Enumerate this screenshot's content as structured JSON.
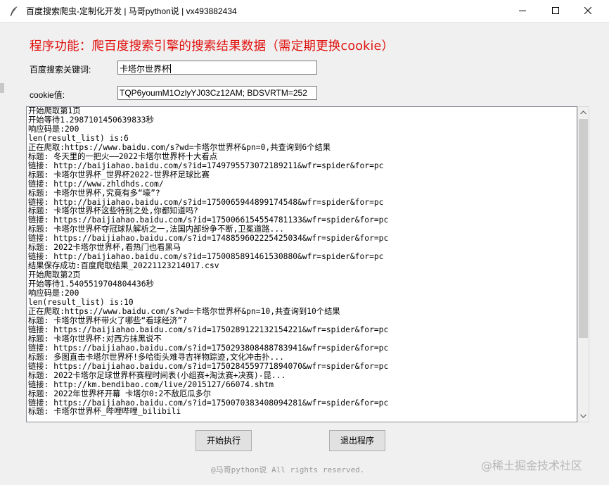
{
  "window": {
    "title": "百度搜索爬虫-定制化开发 | 马哥python说 | vx493882434",
    "controls": {
      "minimize_icon": "minimize-icon",
      "maximize_icon": "maximize-icon",
      "close_icon": "close-icon"
    }
  },
  "heading": "程序功能：爬百度搜索引擎的搜索结果数据（需定期更换cookie）",
  "form": {
    "keyword_label": "百度搜索关键词:",
    "keyword_value": "卡塔尔世界杯",
    "cookie_label": "cookie值:",
    "cookie_value": "TQP6youmM1OzlyYJ03Cz12AM; BDSVRTM=252"
  },
  "log_lines": [
    "开始爬取第1页",
    "开始等待1.2987101450639833秒",
    "响应码是:200",
    "len(result_list) is:6",
    "正在爬取:https://www.baidu.com/s?wd=卡塔尔世界杯&pn=0,共查询到6个结果",
    "标题: 冬天里的一把火——2022卡塔尔世界杯十大看点",
    "链接: http://baijiahao.baidu.com/s?id=1749795573072189211&wfr=spider&for=pc",
    "标题: 卡塔尔世界杯_世界杯2022-世界杯足球比赛",
    "链接: http://www.zhldhds.com/",
    "标题: 卡塔尔世界杯,究竟有多“壕”?",
    "链接: http://baijiahao.baidu.com/s?id=1750065944899174548&wfr=spider&for=pc",
    "标题: 卡塔尔世界杯这些特别之处,你都知道吗?",
    "链接: https://baijiahao.baidu.com/s?id=1750066154554781133&wfr=spider&for=pc",
    "标题: 卡塔尔世界杯夺冠球队解析之一,法国内部纷争不断,卫冕道路...",
    "链接: https://baijiahao.baidu.com/s?id=1748859602225425034&wfr=spider&for=pc",
    "标题: 2022卡塔尔世界杯,看热门也看黑马",
    "链接: http://baijiahao.baidu.com/s?id=1750085891461530880&wfr=spider&for=pc",
    "结果保存成功:百度爬取结果_20221123214017.csv",
    "开始爬取第2页",
    "开始等待1.5405519704804436秒",
    "响应码是:200",
    "len(result_list) is:10",
    "正在爬取:https://www.baidu.com/s?wd=卡塔尔世界杯&pn=10,共查询到10个结果",
    "标题: 卡塔尔世界杯带火了哪些“看球经济”?",
    "链接: https://baijiahao.baidu.com/s?id=1750289122132154221&wfr=spider&for=pc",
    "标题: 卡塔尔世界杯:对西方抹黑说不",
    "链接: https://baijiahao.baidu.com/s?id=1750293808488783941&wfr=spider&for=pc",
    "标题: 多图直击卡塔尔世界杯!多哈街头难寻吉祥物踪迹,文化冲击扑...",
    "链接: https://baijiahao.baidu.com/s?id=1750284559771894070&wfr=spider&for=pc",
    "标题: 2022卡塔尔足球世界杯赛程时间表(小组赛+淘汰赛+决赛)-昆...",
    "链接: http://km.bendibao.com/live/2015127/66074.shtm",
    "标题: 2022年世界杯开幕 卡塔尔0:2不敌厄瓜多尔",
    "链接: https://baijiahao.baidu.com/s?id=1750070383408094281&wfr=spider&for=pc",
    "标题: 卡塔尔世界杯_哔哩哔哩_bilibili"
  ],
  "buttons": {
    "run": "开始执行",
    "quit": "退出程序"
  },
  "footer": "@马哥python说 All rights reserved.",
  "watermark": "@稀土掘金技术社区"
}
